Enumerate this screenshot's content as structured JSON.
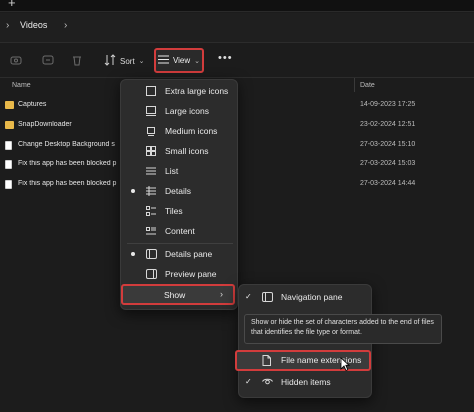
{
  "tabstrip": {
    "new_tab_glyph": "+"
  },
  "address": {
    "breadcrumb": "Videos",
    "chevron": "›"
  },
  "toolbar": {
    "sort_label": "Sort",
    "view_label": "View",
    "more_label": "•••",
    "icons": [
      "share-icon",
      "rename-icon",
      "delete-icon",
      "sort-icon",
      "view-icon",
      "more-icon"
    ]
  },
  "columns": {
    "name": "Name",
    "date": "Date"
  },
  "files": [
    {
      "name": "Captures",
      "date": "14-09-2023 17:25",
      "kind": "folder"
    },
    {
      "name": "SnapDownloader",
      "date": "23-02-2024 12:51",
      "kind": "folder"
    },
    {
      "name": "Change Desktop Background s",
      "date": "27-03-2024 15:10",
      "kind": "document"
    },
    {
      "name": "Fix this app has been blocked p",
      "date": "27-03-2024 15:03",
      "kind": "document"
    },
    {
      "name": "Fix this app has been blocked p",
      "date": "27-03-2024 14:44",
      "kind": "document"
    }
  ],
  "view_menu": {
    "items": [
      {
        "label": "Extra large icons",
        "icon": "extra-large-icons-icon"
      },
      {
        "label": "Large icons",
        "icon": "large-icons-icon"
      },
      {
        "label": "Medium icons",
        "icon": "medium-icons-icon"
      },
      {
        "label": "Small icons",
        "icon": "small-icons-icon"
      },
      {
        "label": "List",
        "icon": "list-icon"
      },
      {
        "label": "Details",
        "icon": "details-icon",
        "selected": true
      },
      {
        "label": "Tiles",
        "icon": "tiles-icon"
      },
      {
        "label": "Content",
        "icon": "content-icon"
      }
    ],
    "panes": [
      {
        "label": "Details pane",
        "icon": "details-pane-icon",
        "selected": true
      },
      {
        "label": "Preview pane",
        "icon": "preview-pane-icon"
      }
    ],
    "show_label": "Show",
    "show_arrow": "›"
  },
  "show_menu": {
    "items": [
      {
        "label": "Navigation pane",
        "checked": true,
        "icon": "navigation-pane-icon"
      },
      {
        "label": "File name extensions",
        "checked": false,
        "icon": "file-icon",
        "highlighted": true
      },
      {
        "label": "Hidden items",
        "checked": true,
        "icon": "eye-icon"
      }
    ],
    "check_glyph": "✓"
  },
  "tooltip": {
    "text": "Show or hide the set of characters added to the end of files that identifies the file type or format."
  },
  "colors": {
    "highlight": "#d23c3c",
    "folder": "#e9b94a",
    "background": "#1c1c1c",
    "menu": "#2c2c2c"
  }
}
